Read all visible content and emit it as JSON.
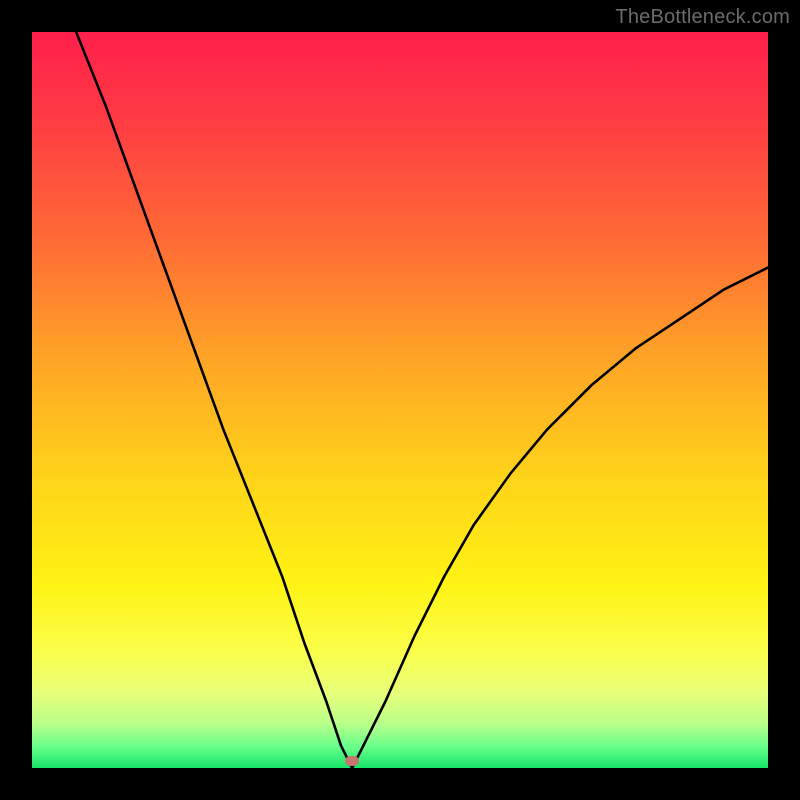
{
  "watermark": "TheBottleneck.com",
  "marker": {
    "x_pct": 43.5,
    "y_pct": 99.0,
    "color": "#c5766d"
  },
  "gradient_stops": [
    {
      "offset": 0,
      "color": "#ff1f4b"
    },
    {
      "offset": 12,
      "color": "#ff3b43"
    },
    {
      "offset": 28,
      "color": "#ff6a35"
    },
    {
      "offset": 45,
      "color": "#ffa626"
    },
    {
      "offset": 60,
      "color": "#ffd21a"
    },
    {
      "offset": 75,
      "color": "#fff314"
    },
    {
      "offset": 84,
      "color": "#fbff4a"
    },
    {
      "offset": 90,
      "color": "#e6ff7a"
    },
    {
      "offset": 94,
      "color": "#b8ff8a"
    },
    {
      "offset": 97,
      "color": "#6bff8a"
    },
    {
      "offset": 100,
      "color": "#17e56a"
    }
  ],
  "chart_data": {
    "type": "line",
    "title": "",
    "xlabel": "",
    "ylabel": "",
    "xlim": [
      0,
      100
    ],
    "ylim": [
      0,
      100
    ],
    "series": [
      {
        "name": "bottleneck-curve",
        "x": [
          6,
          10,
          14,
          18,
          22,
          26,
          30,
          34,
          37,
          40,
          42,
          43.5,
          45,
          48,
          52,
          56,
          60,
          65,
          70,
          76,
          82,
          88,
          94,
          100
        ],
        "y": [
          100,
          90,
          79,
          68,
          57,
          46,
          36,
          26,
          17,
          9,
          3,
          0,
          3,
          9,
          18,
          26,
          33,
          40,
          46,
          52,
          57,
          61,
          65,
          68
        ]
      }
    ],
    "annotations": [
      {
        "text": "TheBottleneck.com",
        "position": "top-right"
      }
    ],
    "marker_point": {
      "x": 43.5,
      "y": 0
    }
  }
}
